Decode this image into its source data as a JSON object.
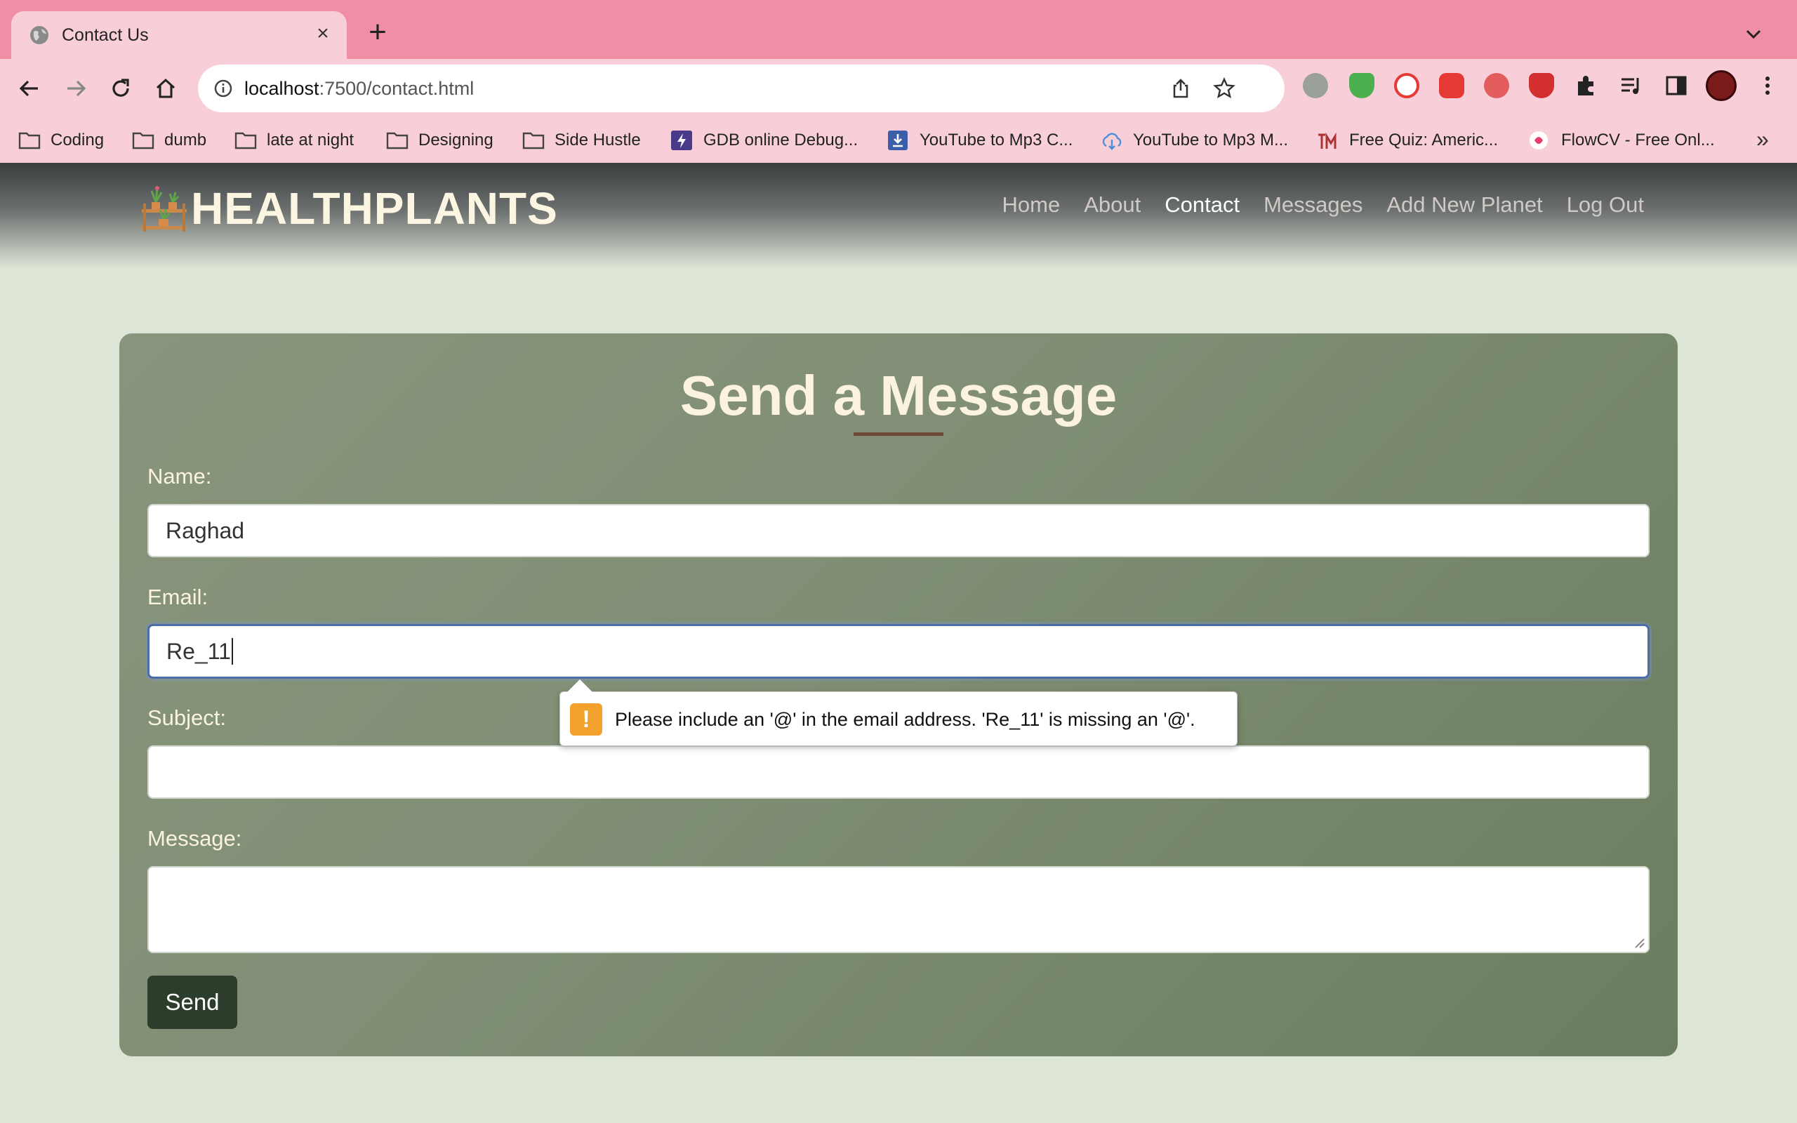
{
  "browser": {
    "tab_title": "Contact Us",
    "url_host": "localhost",
    "url_path": ":7500/contact.html",
    "bookmarks": [
      {
        "label": "Coding",
        "icon": "folder-icon"
      },
      {
        "label": "dumb",
        "icon": "folder-icon"
      },
      {
        "label": "late at night",
        "icon": "folder-icon"
      },
      {
        "label": "Designing",
        "icon": "folder-icon"
      },
      {
        "label": "Side Hustle",
        "icon": "folder-icon"
      },
      {
        "label": "GDB online Debug...",
        "icon": "gdb-icon"
      },
      {
        "label": "YouTube to Mp3 C...",
        "icon": "download-icon"
      },
      {
        "label": "YouTube to Mp3 M...",
        "icon": "cloud-download-icon"
      },
      {
        "label": "Free Quiz: Americ...",
        "icon": "quiz-icon"
      },
      {
        "label": "FlowCV - Free Onl...",
        "icon": "flowcv-icon"
      }
    ],
    "bookmarks_overflow": "»"
  },
  "site": {
    "logo_text": "HEALTHPLANTS",
    "nav": [
      {
        "label": "Home"
      },
      {
        "label": "About"
      },
      {
        "label": "Contact",
        "active": true
      },
      {
        "label": "Messages"
      },
      {
        "label": "Add New Planet"
      },
      {
        "label": "Log Out"
      }
    ]
  },
  "form": {
    "title": "Send a Message",
    "name_label": "Name:",
    "name_value": "Raghad",
    "email_label": "Email:",
    "email_value": "Re_11",
    "subject_label": "Subject:",
    "subject_value": "",
    "message_label": "Message:",
    "message_value": "",
    "send_label": "Send"
  },
  "validation": {
    "message": "Please include an '@' in the email address. 'Re_11' is missing an '@'.",
    "icon": "warning-icon"
  },
  "colors": {
    "tabstrip": "#f08ea6",
    "toolbar": "#f8cfd9",
    "page_bg": "#dde5d7",
    "card": "#7f8e74",
    "title_text": "#fbf3e0",
    "button": "#2c3e2b",
    "warning": "#f2a12e"
  }
}
